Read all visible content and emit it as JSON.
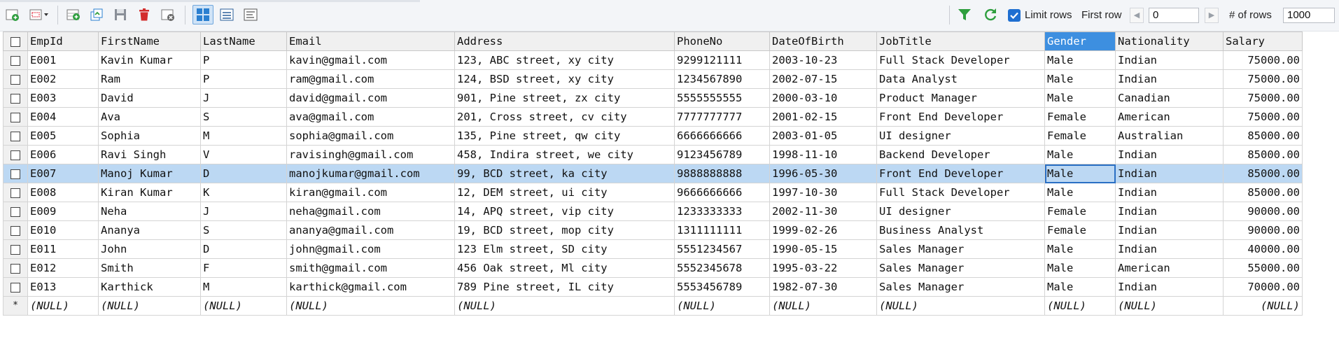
{
  "toolbar": {
    "buttons": [
      {
        "name": "refresh-data-icon"
      },
      {
        "name": "filter-dropdown-icon"
      },
      {
        "name": "insert-row-icon"
      },
      {
        "name": "duplicate-row-icon"
      },
      {
        "name": "save-icon"
      },
      {
        "name": "delete-row-icon"
      },
      {
        "name": "cancel-changes-icon"
      },
      {
        "name": "grid-view-icon"
      },
      {
        "name": "form-view-icon"
      },
      {
        "name": "text-view-icon"
      }
    ],
    "limit_rows_label": "Limit rows",
    "limit_rows_checked": true,
    "first_row_label": "First row",
    "first_row_value": "0",
    "num_rows_label": "# of rows",
    "num_rows_value": "1000",
    "filter_color": "#2e9e3e",
    "accent": "#1f6fd1"
  },
  "grid": {
    "columns": [
      "EmpId",
      "FirstName",
      "LastName",
      "Email",
      "Address",
      "PhoneNo",
      "DateOfBirth",
      "JobTitle",
      "Gender",
      "Nationality",
      "Salary"
    ],
    "selected_column": "Gender",
    "selected_row_index": 6,
    "rows": [
      [
        "E001",
        "Kavin Kumar",
        "P",
        "kavin@gmail.com",
        "123, ABC street, xy city",
        "9299121111",
        "2003-10-23",
        "Full Stack Developer",
        "Male",
        "Indian",
        "75000.00"
      ],
      [
        "E002",
        "Ram",
        "P",
        "ram@gmail.com",
        "124, BSD street, xy city",
        "1234567890",
        "2002-07-15",
        "Data Analyst",
        "Male",
        "Indian",
        "75000.00"
      ],
      [
        "E003",
        "David",
        "J",
        "david@gmail.com",
        "901, Pine street, zx city",
        "5555555555",
        "2000-03-10",
        "Product Manager",
        "Male",
        "Canadian",
        "75000.00"
      ],
      [
        "E004",
        "Ava",
        "S",
        "ava@gmail.com",
        "201, Cross street, cv city",
        "7777777777",
        "2001-02-15",
        "Front End Developer",
        "Female",
        "American",
        "75000.00"
      ],
      [
        "E005",
        "Sophia",
        "M",
        "sophia@gmail.com",
        "135, Pine street, qw city",
        "6666666666",
        "2003-01-05",
        "UI designer",
        "Female",
        "Australian",
        "85000.00"
      ],
      [
        "E006",
        "Ravi Singh",
        "V",
        "ravisingh@gmail.com",
        "458, Indira street, we city",
        "9123456789",
        "1998-11-10",
        "Backend Developer",
        "Male",
        "Indian",
        "85000.00"
      ],
      [
        "E007",
        "Manoj Kumar",
        "D",
        "manojkumar@gmail.com",
        "99, BCD street, ka city",
        "9888888888",
        "1996-05-30",
        "Front End Developer",
        "Male",
        "Indian",
        "85000.00"
      ],
      [
        "E008",
        "Kiran Kumar",
        "K",
        "kiran@gmail.com",
        "12, DEM street, ui city",
        "9666666666",
        "1997-10-30",
        "Full Stack Developer",
        "Male",
        "Indian",
        "85000.00"
      ],
      [
        "E009",
        "Neha",
        "J",
        "neha@gmail.com",
        "14, APQ street, vip city",
        "1233333333",
        "2002-11-30",
        "UI designer",
        "Female",
        "Indian",
        "90000.00"
      ],
      [
        "E010",
        "Ananya",
        "S",
        "ananya@gmail.com",
        "19, BCD street, mop city",
        "1311111111",
        "1999-02-26",
        "Business Analyst",
        "Female",
        "Indian",
        "90000.00"
      ],
      [
        "E011",
        "John",
        "D",
        "john@gmail.com",
        "123 Elm street, SD city",
        "5551234567",
        "1990-05-15",
        "Sales Manager",
        "Male",
        "Indian",
        "40000.00"
      ],
      [
        "E012",
        "Smith",
        "F",
        "smith@gmail.com",
        "456 Oak street, Ml city",
        "5552345678",
        "1995-03-22",
        "Sales Manager",
        "Male",
        "American",
        "55000.00"
      ],
      [
        "E013",
        "Karthick",
        "M",
        "karthick@gmail.com",
        "789 Pine street, IL city",
        "5553456789",
        "1982-07-30",
        "Sales Manager",
        "Male",
        "Indian",
        "70000.00"
      ]
    ],
    "new_row_marker": "*",
    "null_text": "(NULL)"
  }
}
